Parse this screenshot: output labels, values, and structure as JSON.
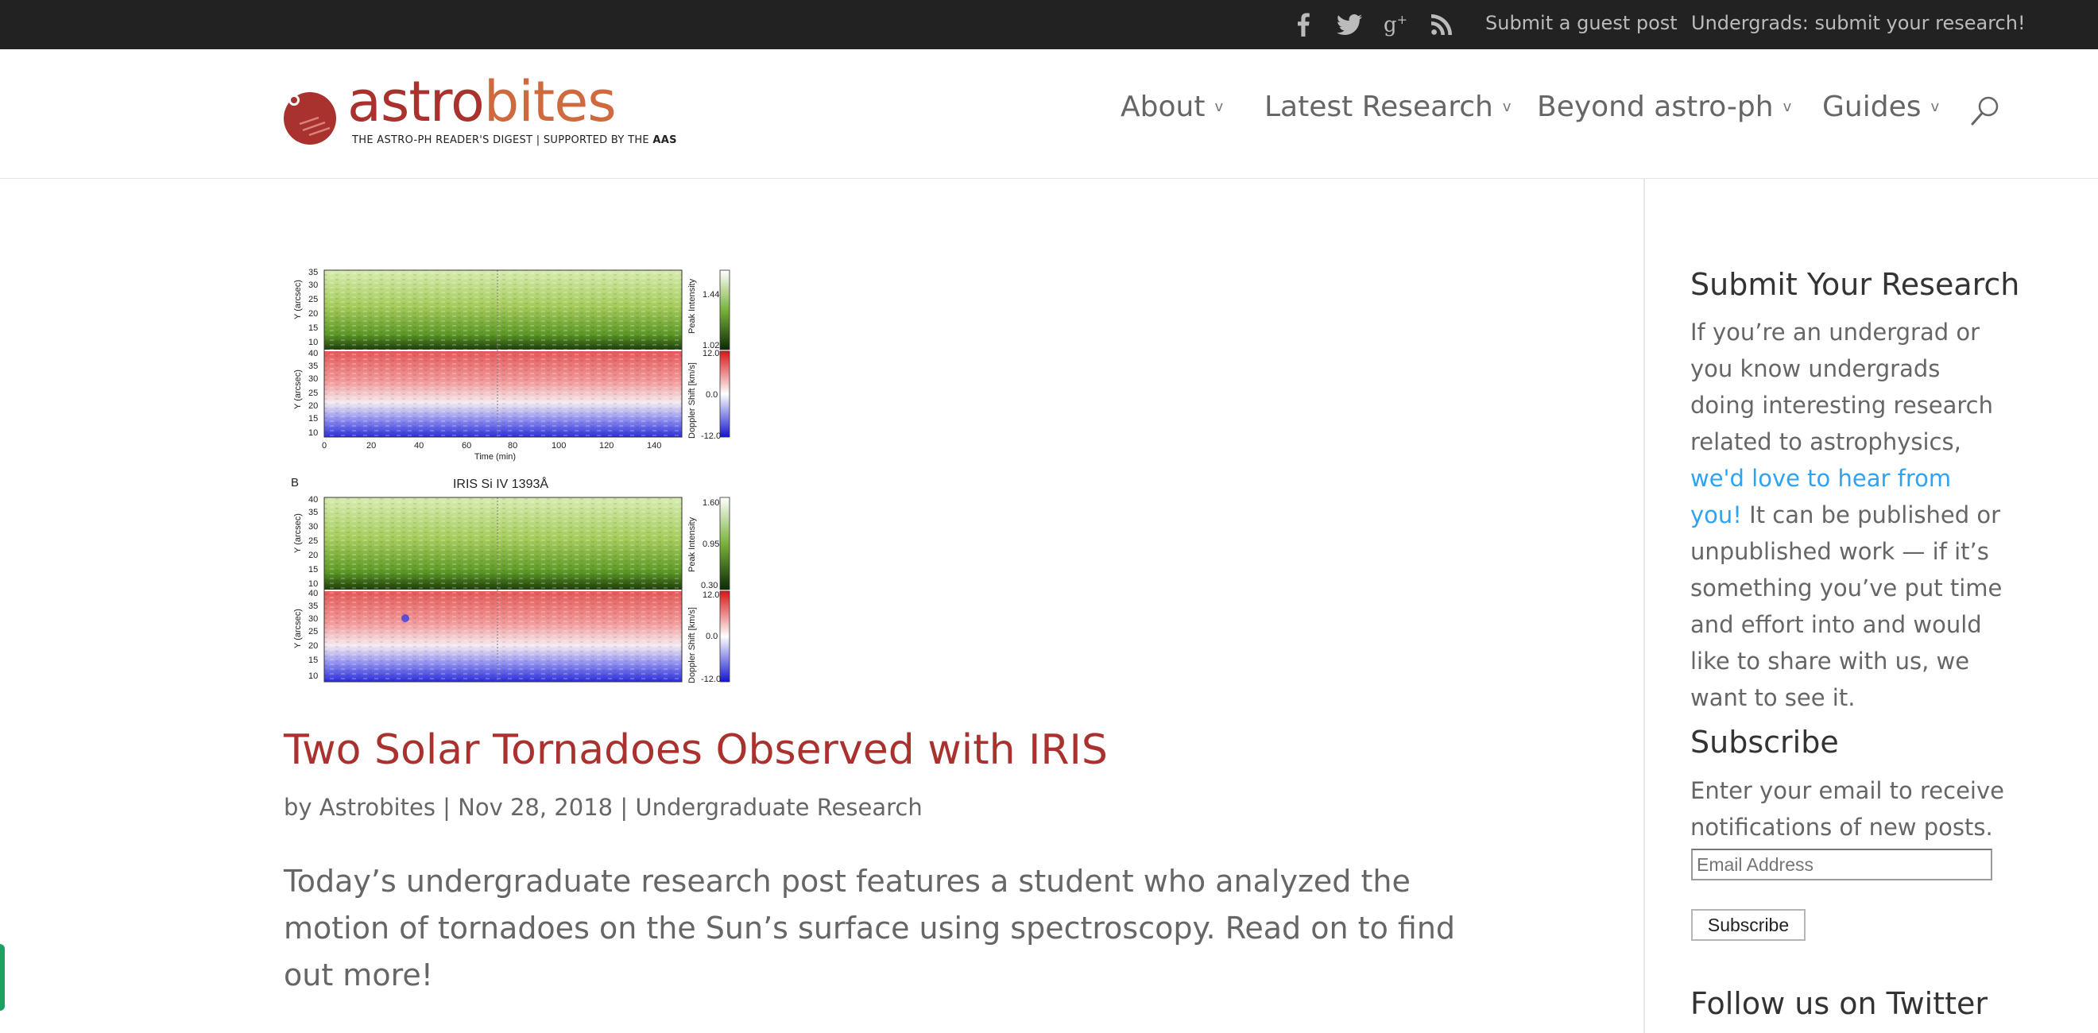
{
  "topbar": {
    "social_icons": [
      "facebook-icon",
      "twitter-icon",
      "google-plus-icon",
      "rss-icon"
    ],
    "links": [
      "Submit a guest post",
      "Undergrads: submit your research!"
    ]
  },
  "logo": {
    "word_part1": "astro",
    "word_part2": "bites",
    "tagline": "THE ASTRO-PH READER'S DIGEST | SUPPORTED BY THE",
    "tagline_bold": "AAS"
  },
  "nav": {
    "items": [
      {
        "label": "About",
        "chevron": "v"
      },
      {
        "label": "Latest Research",
        "chevron": "v"
      },
      {
        "label": "Beyond astro-ph",
        "chevron": "v"
      },
      {
        "label": "Guides",
        "chevron": "v"
      }
    ]
  },
  "post": {
    "title": "Two Solar Tornadoes Observed with IRIS",
    "meta_prefix": "by",
    "author": "Astrobites",
    "separator": "|",
    "date": "Nov 28, 2018",
    "category": "Undergraduate Research",
    "excerpt": "Today’s undergraduate research post features a student who analyzed the motion of tornadoes on the Sun’s surface using spectroscopy. Read on to find out more!"
  },
  "figure": {
    "panel_a": {
      "ylabel": "Y (arcsec)",
      "yticks_top": [
        "35",
        "30",
        "25",
        "20",
        "15",
        "10"
      ],
      "yticks_bottom": [
        "40",
        "35",
        "30",
        "25",
        "20",
        "15",
        "10"
      ],
      "xticks": [
        "0",
        "20",
        "40",
        "60",
        "80",
        "100",
        "120",
        "140"
      ],
      "xlabel": "Time (min)",
      "cb_top_label": "Peak Intensity",
      "cb_top_ticks": [
        "1.44",
        "1.02"
      ],
      "cb_bottom_label": "Doppler Shift [km/s]",
      "cb_bottom_ticks": [
        "12.0",
        "0.0",
        "-12.0"
      ]
    },
    "panel_b": {
      "letter": "B",
      "title": "IRIS Si IV 1393Å",
      "ylabel": "Y (arcsec)",
      "yticks_top": [
        "40",
        "35",
        "30",
        "25",
        "20",
        "15",
        "10"
      ],
      "yticks_bottom": [
        "40",
        "35",
        "30",
        "25",
        "20",
        "15",
        "10"
      ],
      "cb_top_label": "Peak Intensity",
      "cb_top_ticks": [
        "1.60",
        "0.95",
        "0.30"
      ],
      "cb_bottom_label": "Doppler Shift [km/s]",
      "cb_bottom_ticks": [
        "12.0",
        "0.0",
        "-12.0"
      ]
    }
  },
  "sidebar": {
    "submit": {
      "title": "Submit Your Research",
      "text_before": "If you’re an undergrad or you know undergrads doing interesting research related to astrophysics,",
      "link": "we'd love to hear from you!",
      "text_after": "It can be published or unpublished work — if it’s something you’ve put time and effort into and would like to share with us, we want to see it."
    },
    "subscribe": {
      "title": "Subscribe",
      "text": "Enter your email to receive notifications of new posts.",
      "placeholder": "Email Address",
      "button": "Subscribe"
    },
    "twitter": {
      "title": "Follow us on Twitter"
    }
  },
  "colors": {
    "topbar_bg": "#222222",
    "title_red": "#a9312e",
    "logo_orange": "#cf6a3f",
    "link_blue": "#2ea3f2",
    "text_gray": "#666666",
    "side_tab": "#1aa260"
  }
}
